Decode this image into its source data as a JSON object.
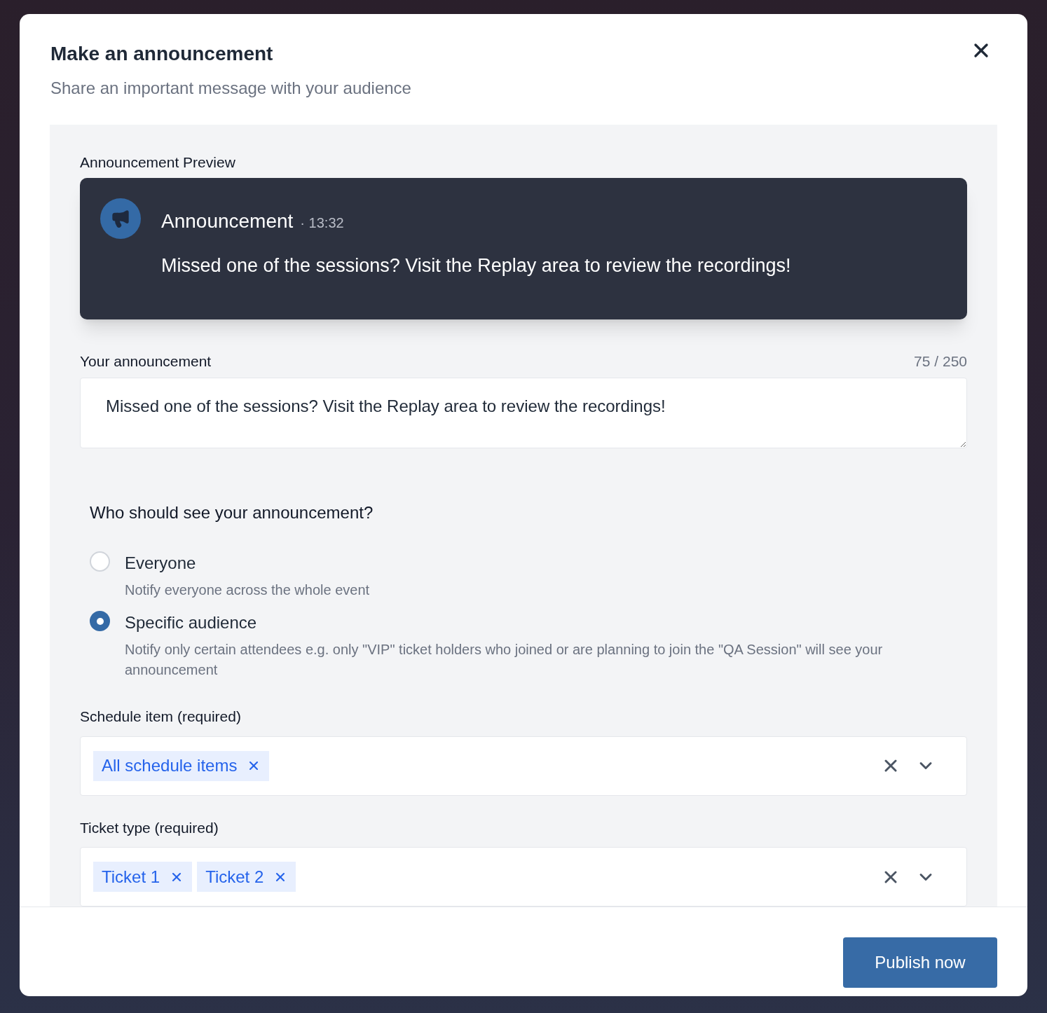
{
  "dialog": {
    "title": "Make an announcement",
    "subtitle": "Share an important message with your audience"
  },
  "preview": {
    "label": "Announcement Preview",
    "title": "Announcement",
    "meta": "· 13:32",
    "message": "Missed one of the sessions? Visit the Replay area to review the recordings!"
  },
  "announcement": {
    "label": "Your announcement",
    "counter": "75 / 250",
    "value": "Missed one of the sessions? Visit the Replay area to review the recordings!"
  },
  "audience": {
    "question": "Who should see your announcement?",
    "options": [
      {
        "label": "Everyone",
        "description": "Notify everyone across the whole event",
        "selected": false
      },
      {
        "label": "Specific audience",
        "description": "Notify only certain attendees e.g. only \"VIP\" ticket holders who joined or are planning to join the \"QA Session\" will see your announcement",
        "selected": true
      }
    ]
  },
  "selects": [
    {
      "label": "Schedule item (required)",
      "tags": [
        "All schedule items"
      ]
    },
    {
      "label": "Ticket type (required)",
      "tags": [
        "Ticket 1",
        "Ticket 2"
      ]
    }
  ],
  "publish_button": "Publish now"
}
